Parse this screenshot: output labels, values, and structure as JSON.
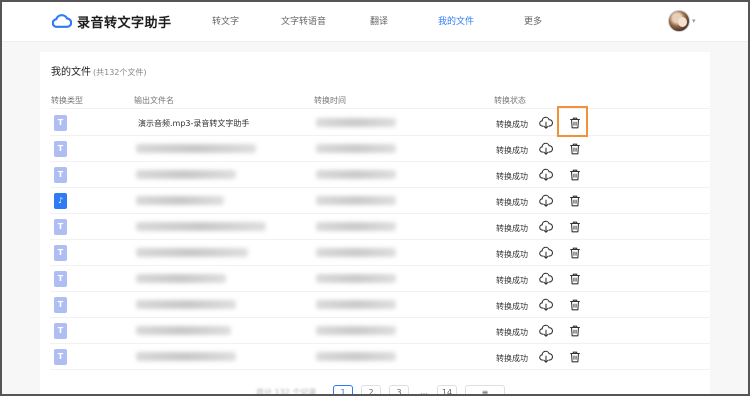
{
  "app": {
    "name": "录音转文字助手"
  },
  "nav": {
    "items": [
      "转文字",
      "文字转语音",
      "翻译",
      "我的文件",
      "更多"
    ],
    "active_index": 3
  },
  "files": {
    "title": "我的文件",
    "count_text": "(共132个文件)",
    "columns": [
      "转换类型",
      "输出文件名",
      "转换时间",
      "转换状态"
    ],
    "rows": [
      {
        "type": "T",
        "name": "演示音频.mp3-录音转文字助手",
        "status": "转换成功"
      },
      {
        "type": "T",
        "name": "",
        "status": "转换成功"
      },
      {
        "type": "T",
        "name": "",
        "status": "转换成功"
      },
      {
        "type": "audio",
        "name": "",
        "status": "转换成功"
      },
      {
        "type": "T",
        "name": "",
        "status": "转换成功"
      },
      {
        "type": "T",
        "name": "",
        "status": "转换成功"
      },
      {
        "type": "T",
        "name": "",
        "status": "转换成功"
      },
      {
        "type": "T",
        "name": "",
        "status": "转换成功"
      },
      {
        "type": "T",
        "name": "",
        "status": "转换成功"
      },
      {
        "type": "T",
        "name": "",
        "status": "转换成功"
      }
    ]
  },
  "pagination": {
    "pages": [
      "1",
      "2",
      "3",
      "14"
    ],
    "current": "1",
    "dots": "…"
  },
  "colors": {
    "accent": "#2f7bf5",
    "highlight": "#f0923a",
    "file_icon": "#aebdf2"
  },
  "icons": {
    "download": "cloud-download-icon",
    "delete": "trash-icon",
    "logo": "cloud-logo-icon"
  }
}
